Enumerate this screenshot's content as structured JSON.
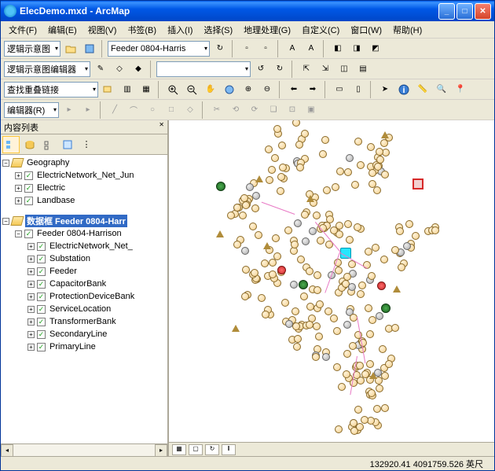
{
  "window": {
    "title": "ElecDemo.mxd - ArcMap"
  },
  "menu": {
    "file": "文件(F)",
    "edit": "编辑(E)",
    "view": "视图(V)",
    "bookmark": "书签(B)",
    "insert": "插入(I)",
    "select": "选择(S)",
    "geoprocess": "地理处理(G)",
    "custom": "自定义(C)",
    "window": "窗口(W)",
    "help": "帮助(H)"
  },
  "toolbar1": {
    "diagram_label": "逻辑示意图",
    "feeder_value": "Feeder 0804-Harris"
  },
  "toolbar2": {
    "editor_label": "逻辑示意图编辑器"
  },
  "toolbar3": {
    "search_value": "查找重叠链接"
  },
  "toolbar4": {
    "editor_label": "编辑器(R)"
  },
  "toc": {
    "title": "内容列表",
    "geography": "Geography",
    "elecnet": "ElectricNetwork_Net_Jun",
    "electric": "Electric",
    "landbase": "Landbase",
    "dataframe": "数据框 Feeder 0804-Harr",
    "feeder_full": "Feeder 0804-Harrison",
    "elecnet2": "ElectricNetwork_Net_",
    "substation": "Substation",
    "feeder": "Feeder",
    "capacitor": "CapacitorBank",
    "protection": "ProtectionDeviceBank",
    "service": "ServiceLocation",
    "transformer": "TransformerBank",
    "secondary": "SecondaryLine",
    "primary": "PrimaryLine"
  },
  "status": {
    "coords": "132920.41  4091759.526 英尺"
  }
}
